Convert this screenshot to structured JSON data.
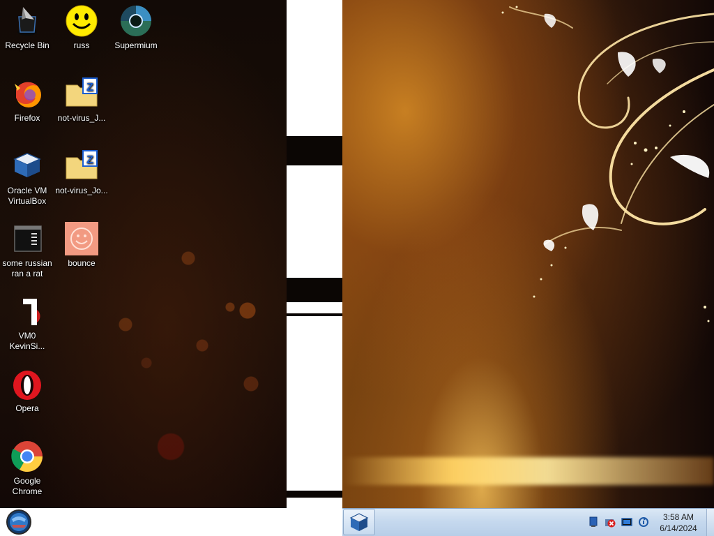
{
  "desktop": {
    "icons": [
      {
        "label": "Recycle Bin",
        "icon": "recycle-bin-icon"
      },
      {
        "label": "russ",
        "icon": "smiley-icon"
      },
      {
        "label": "Supermium",
        "icon": "supermium-icon"
      },
      {
        "label": "Firefox",
        "icon": "firefox-icon"
      },
      {
        "label": "not-virus_J...",
        "icon": "zip-folder-icon"
      },
      {
        "label": "Oracle VM VirtualBox",
        "icon": "virtualbox-icon"
      },
      {
        "label": "not-virus_Jo...",
        "icon": "zip-folder-icon"
      },
      {
        "label": "some russian ran a rat",
        "icon": "console-app-icon"
      },
      {
        "label": "bounce",
        "icon": "bounce-smiley-icon"
      },
      {
        "label": "VM0 KevinSi...",
        "icon": "shortcut-file-icon"
      },
      {
        "label": "Opera",
        "icon": "opera-icon"
      },
      {
        "label": "Google Chrome",
        "icon": "chrome-icon"
      }
    ]
  },
  "taskbar": {
    "start_icon": "start-orb-icon",
    "pinned": [
      {
        "icon": "virtualbox-icon"
      }
    ],
    "tray": [
      {
        "icon": "network-icon"
      },
      {
        "icon": "error-x-icon"
      },
      {
        "icon": "monitor-icon"
      },
      {
        "icon": "sync-icon"
      }
    ],
    "clock": {
      "time": "3:58 AM",
      "date": "6/14/2024"
    }
  },
  "colors": {
    "taskbar_top": "#dbe8f5",
    "taskbar_bottom": "#b7cee8",
    "wallpaper_gold": "#f2b84a"
  }
}
